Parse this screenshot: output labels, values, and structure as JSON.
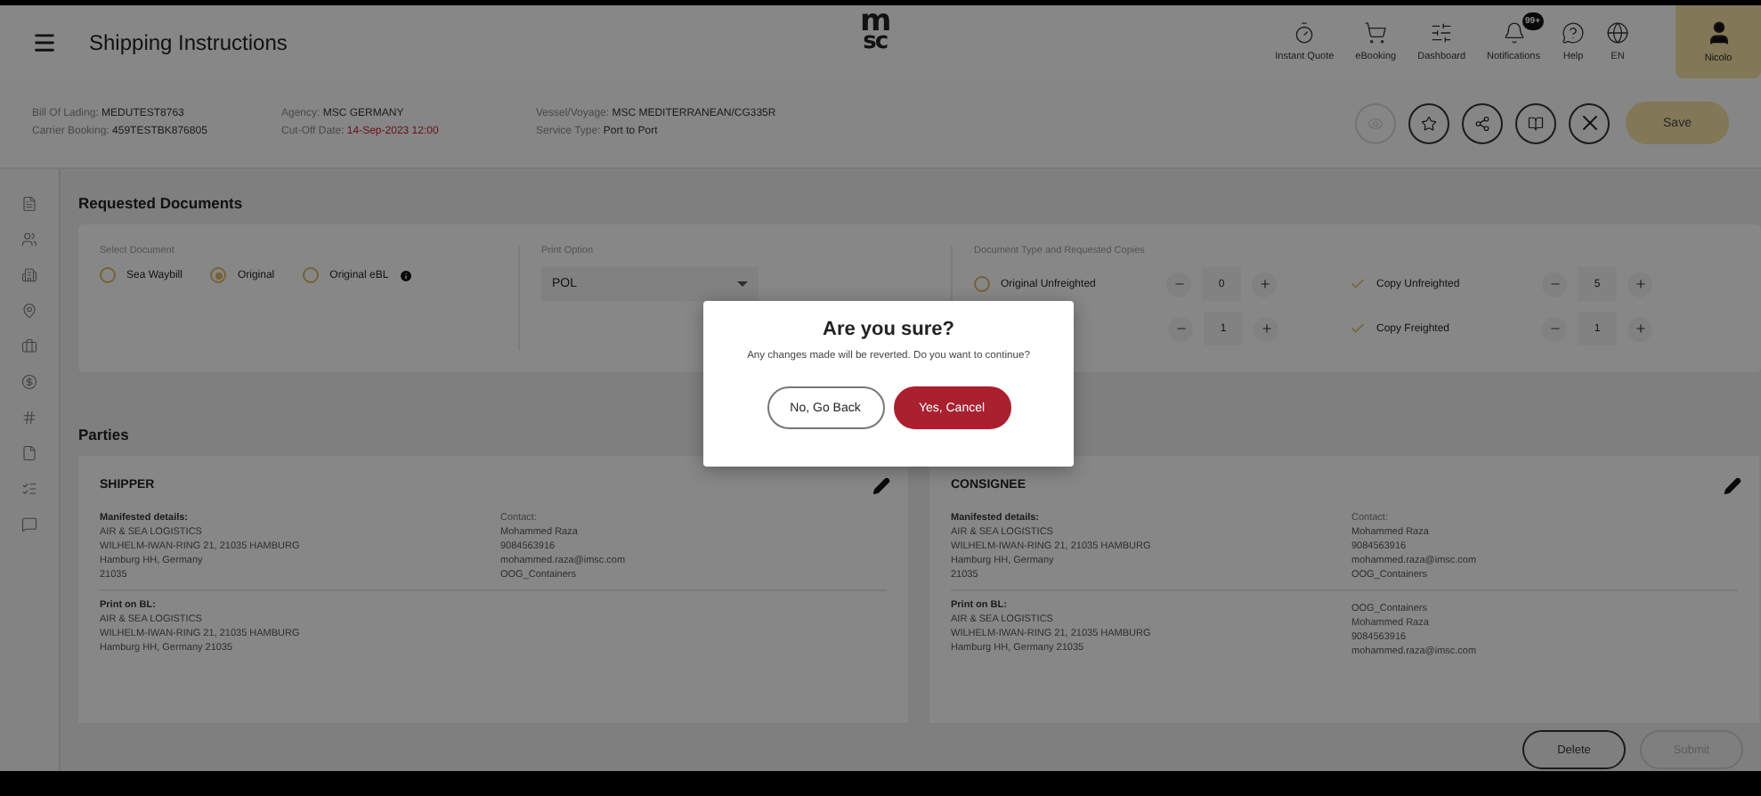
{
  "header": {
    "title": "Shipping Instructions",
    "logo": [
      "m",
      "sc"
    ],
    "nav": [
      {
        "label": "Instant Quote"
      },
      {
        "label": "eBooking"
      },
      {
        "label": "Dashboard"
      },
      {
        "label": "Notifications",
        "badge": "99+"
      },
      {
        "label": "Help"
      },
      {
        "label": "EN"
      }
    ],
    "user": "Nicolo"
  },
  "info": [
    {
      "label": "Bill Of Lading:",
      "value": "MEDUTEST8763",
      "alert": false
    },
    {
      "label": "Carrier Booking:",
      "value": "459TESTBK876805",
      "alert": false
    },
    {
      "label": "Agency:",
      "value": "MSC GERMANY",
      "alert": false
    },
    {
      "label": "Cut-Off Date:",
      "value": "14-Sep-2023 12:00",
      "alert": true
    },
    {
      "label": "Vessel/Voyage:",
      "value": "MSC MEDITERRANEAN/CG335R",
      "alert": false
    },
    {
      "label": "Service Type:",
      "value": "Port to Port",
      "alert": false
    }
  ],
  "toolbar_buttons": [
    {
      "disabled": true
    },
    {
      "disabled": false
    },
    {
      "disabled": false
    },
    {
      "disabled": false
    },
    {
      "disabled": false
    }
  ],
  "save_button": "Save",
  "requested_documents": {
    "title": "Requested Documents",
    "select_document": {
      "label": "Select Document",
      "options": [
        {
          "label": "Sea Waybill",
          "selected": false,
          "info": false
        },
        {
          "label": "Original",
          "selected": true,
          "info": false
        },
        {
          "label": "Original eBL",
          "selected": false,
          "info": true
        }
      ]
    },
    "print_option": {
      "label": "Print Option",
      "value": "POL"
    },
    "document_types": {
      "label": "Document Type and Requested Copies",
      "items": [
        {
          "kind": "radio",
          "label": "Original Unfreighted",
          "selected": false,
          "count": "0"
        },
        {
          "kind": "hidden",
          "count": "1"
        },
        {
          "kind": "check",
          "label": "Copy Unfreighted",
          "checked": true,
          "count": "5"
        },
        {
          "kind": "check",
          "label": "Copy Freighted",
          "checked": true,
          "count": "1"
        }
      ]
    }
  },
  "parties": {
    "title": "Parties",
    "cards": [
      {
        "title": "SHIPPER",
        "manifested_label": "Manifested details:",
        "manifested": [
          "AIR & SEA LOGISTICS",
          "WILHELM-IWAN-RING 21, 21035 HAMBURG",
          "Hamburg HH, Germany",
          "21035"
        ],
        "contact_label": "Contact:",
        "contact": [
          "Mohammed Raza",
          "9084563916",
          "mohammed.raza@imsc.com",
          "OOG_Containers"
        ],
        "print_label": "Print on BL:",
        "print": [
          "AIR & SEA LOGISTICS",
          "WILHELM-IWAN-RING 21, 21035 HAMBURG",
          "Hamburg HH, Germany 21035"
        ]
      },
      {
        "title": "CONSIGNEE",
        "manifested_label": "Manifested details:",
        "manifested": [
          "AIR & SEA LOGISTICS",
          "WILHELM-IWAN-RING 21, 21035 HAMBURG",
          "Hamburg HH, Germany",
          "21035"
        ],
        "contact_label": "Contact:",
        "contact": [
          "Mohammed Raza",
          "9084563916",
          "mohammed.raza@imsc.com",
          "OOG_Containers"
        ],
        "print_label": "Print on BL:",
        "print": [
          "AIR & SEA LOGISTICS",
          "WILHELM-IWAN-RING 21, 21035 HAMBURG",
          "Hamburg HH, Germany 21035"
        ],
        "print_contact": [
          "OOG_Containers",
          "Mohammed Raza",
          "9084563916",
          "mohammed.raza@imsc.com"
        ]
      }
    ]
  },
  "footer_buttons": [
    {
      "label": "Delete",
      "disabled": false
    },
    {
      "label": "Submit",
      "disabled": true
    }
  ],
  "dialog": {
    "title": "Are you sure?",
    "message": "Any changes made will be reverted. Do you want to continue?",
    "buttons": [
      {
        "label": "No, Go Back",
        "kind": "secondary"
      },
      {
        "label": "Yes, Cancel",
        "kind": "primary"
      }
    ]
  }
}
